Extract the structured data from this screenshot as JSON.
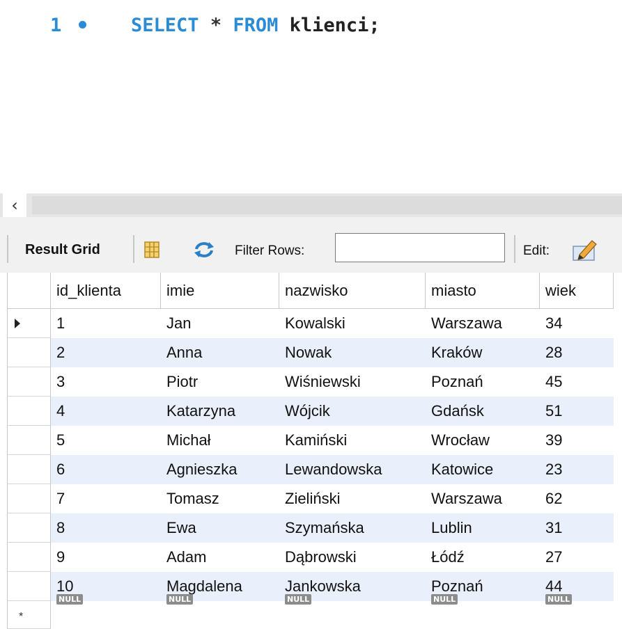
{
  "editor": {
    "line_number": "1",
    "keyword_select": "SELECT",
    "star": "*",
    "keyword_from": "FROM",
    "table_name": "klienci;"
  },
  "toolbar": {
    "result_grid_label": "Result Grid",
    "filter_label": "Filter Rows:",
    "filter_value": "",
    "edit_label": "Edit:"
  },
  "grid": {
    "columns": [
      "id_klienta",
      "imie",
      "nazwisko",
      "miasto",
      "wiek"
    ],
    "rows": [
      [
        "1",
        "Jan",
        "Kowalski",
        "Warszawa",
        "34"
      ],
      [
        "2",
        "Anna",
        "Nowak",
        "Kraków",
        "28"
      ],
      [
        "3",
        "Piotr",
        "Wiśniewski",
        "Poznań",
        "45"
      ],
      [
        "4",
        "Katarzyna",
        "Wójcik",
        "Gdańsk",
        "51"
      ],
      [
        "5",
        "Michał",
        "Kamiński",
        "Wrocław",
        "39"
      ],
      [
        "6",
        "Agnieszka",
        "Lewandowska",
        "Katowice",
        "23"
      ],
      [
        "7",
        "Tomasz",
        "Zieliński",
        "Warszawa",
        "62"
      ],
      [
        "8",
        "Ewa",
        "Szymańska",
        "Lublin",
        "31"
      ],
      [
        "9",
        "Adam",
        "Dąbrowski",
        "Łódź",
        "27"
      ],
      [
        "10",
        "Magdalena",
        "Jankowska",
        "Poznań",
        "44"
      ]
    ],
    "null_label": "NULL",
    "new_row_marker": "*"
  }
}
